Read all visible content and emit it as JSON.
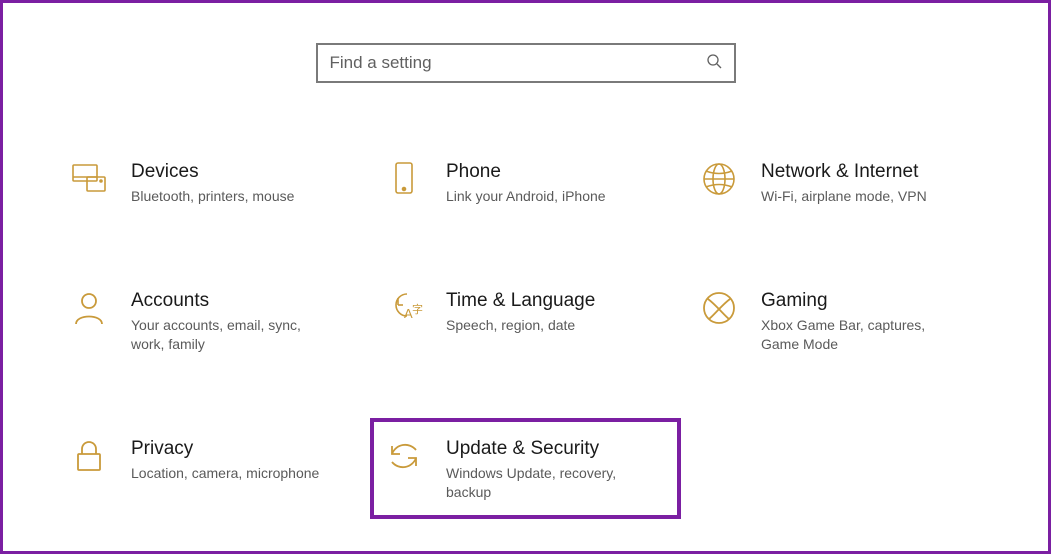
{
  "search": {
    "placeholder": "Find a setting"
  },
  "tiles": {
    "devices": {
      "title": "Devices",
      "sub": "Bluetooth, printers, mouse"
    },
    "phone": {
      "title": "Phone",
      "sub": "Link your Android, iPhone"
    },
    "network": {
      "title": "Network & Internet",
      "sub": "Wi-Fi, airplane mode, VPN"
    },
    "accounts": {
      "title": "Accounts",
      "sub": "Your accounts, email, sync, work, family"
    },
    "time": {
      "title": "Time & Language",
      "sub": "Speech, region, date"
    },
    "gaming": {
      "title": "Gaming",
      "sub": "Xbox Game Bar, captures, Game Mode"
    },
    "privacy": {
      "title": "Privacy",
      "sub": "Location, camera, microphone"
    },
    "update": {
      "title": "Update & Security",
      "sub": "Windows Update, recovery, backup"
    }
  }
}
